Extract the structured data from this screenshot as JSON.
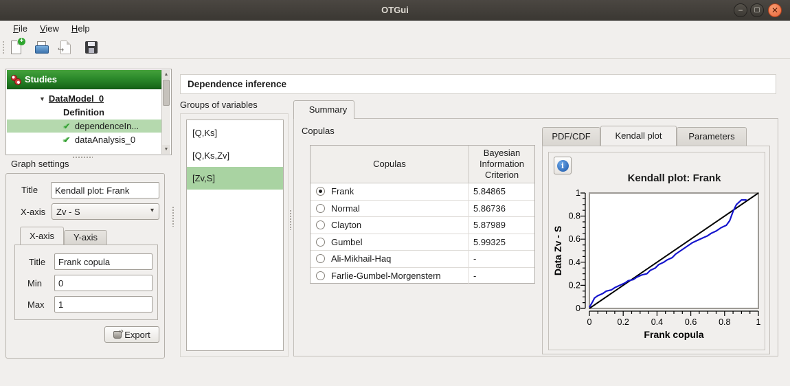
{
  "window": {
    "title": "OTGui"
  },
  "window_controls": {
    "minimize": "−",
    "maximize": "▢",
    "close": "✕"
  },
  "menu": {
    "file": "File",
    "view": "View",
    "help": "Help"
  },
  "toolbar": {
    "buttons": [
      "new-study",
      "open-study",
      "import-python-script",
      "save-study"
    ]
  },
  "studies_tree": {
    "header": "Studies",
    "expander_glyph": "▼",
    "check_glyph": "✔",
    "scroll_up_glyph": "▲",
    "scroll_down_glyph": "▼",
    "items": [
      {
        "label": "DataModel_0",
        "expanded": true,
        "selected": false
      },
      {
        "label": "Definition",
        "expanded": false,
        "selected": false
      },
      {
        "label": "dependenceIn...",
        "expanded": false,
        "selected": true,
        "checked": true
      },
      {
        "label": "dataAnalysis_0",
        "expanded": false,
        "selected": false,
        "checked": true
      }
    ]
  },
  "graph_settings": {
    "section_label": "Graph settings",
    "title_label": "Title",
    "title_value": "Kendall plot: Frank",
    "xaxis_label": "X-axis",
    "xaxis_value": "Zv - S",
    "combo_arrow_glyph": "▾",
    "tabs": [
      {
        "label": "X-axis",
        "active": true
      },
      {
        "label": "Y-axis",
        "active": false
      }
    ],
    "axis_title_label": "Title",
    "axis_title_value": "Frank copula",
    "min_label": "Min",
    "min_value": "0",
    "max_label": "Max",
    "max_value": "1",
    "export_label": "Export"
  },
  "main": {
    "page_title": "Dependence inference",
    "groups_label": "Groups of variables",
    "groups": [
      {
        "label": "[Q,Ks]",
        "selected": false
      },
      {
        "label": "[Q,Ks,Zv]",
        "selected": false
      },
      {
        "label": "[Zv,S]",
        "selected": true
      }
    ],
    "summary_tab": "Summary",
    "copulas_label": "Copulas",
    "table": {
      "col_copulas": "Copulas",
      "col_bic": "Bayesian Information Criterion",
      "rows": [
        {
          "name": "Frank",
          "bic": "5.84865",
          "selected": true
        },
        {
          "name": "Normal",
          "bic": "5.86736",
          "selected": false
        },
        {
          "name": "Clayton",
          "bic": "5.87989",
          "selected": false
        },
        {
          "name": "Gumbel",
          "bic": "5.99325",
          "selected": false
        },
        {
          "name": "Ali-Mikhail-Haq",
          "bic": "-",
          "selected": false
        },
        {
          "name": "Farlie-Gumbel-Morgenstern",
          "bic": "-",
          "selected": false
        }
      ]
    },
    "plot_tabs": [
      {
        "label": "PDF/CDF",
        "active": false
      },
      {
        "label": "Kendall plot",
        "active": true
      },
      {
        "label": "Parameters",
        "active": false
      }
    ],
    "info_glyph": "i"
  },
  "chart_data": {
    "type": "line",
    "title": "Kendall plot: Frank",
    "xlabel": "Frank copula",
    "ylabel": "Data Zv - S",
    "xlim": [
      0,
      1
    ],
    "ylim": [
      0,
      1
    ],
    "xticks": [
      0,
      0.2,
      0.4,
      0.6,
      0.8,
      1
    ],
    "yticks": [
      0,
      0.2,
      0.4,
      0.6,
      0.8,
      1
    ],
    "minor_tick_step": 0.05,
    "grid": false,
    "legend_position": "none",
    "series": [
      {
        "name": "reference y = x",
        "color": "#000000",
        "x": [
          0,
          1
        ],
        "y": [
          0,
          1
        ]
      },
      {
        "name": "empirical Kendall plot (Frank copula)",
        "color": "#1515cd",
        "x": [
          0.0,
          0.02,
          0.03,
          0.05,
          0.08,
          0.1,
          0.13,
          0.15,
          0.18,
          0.21,
          0.23,
          0.26,
          0.28,
          0.31,
          0.34,
          0.36,
          0.39,
          0.41,
          0.44,
          0.46,
          0.49,
          0.51,
          0.54,
          0.56,
          0.59,
          0.61,
          0.64,
          0.67,
          0.7,
          0.72,
          0.75,
          0.78,
          0.81,
          0.83,
          0.85,
          0.87,
          0.9,
          0.93
        ],
        "y": [
          0.01,
          0.06,
          0.09,
          0.11,
          0.13,
          0.15,
          0.16,
          0.18,
          0.2,
          0.22,
          0.24,
          0.25,
          0.27,
          0.29,
          0.3,
          0.33,
          0.35,
          0.38,
          0.4,
          0.42,
          0.44,
          0.47,
          0.5,
          0.52,
          0.55,
          0.57,
          0.59,
          0.61,
          0.63,
          0.65,
          0.67,
          0.7,
          0.72,
          0.76,
          0.84,
          0.9,
          0.94,
          0.94
        ]
      }
    ]
  },
  "colors": {
    "selection_green": "#a9d3a2",
    "tree_selection_green": "#b5d9ae",
    "tree_header_green": "#2c8a2b",
    "titlebar_bg": "#3f3c36",
    "close_button_orange": "#e9663a",
    "info_blue": "#2a66b5",
    "curve_blue": "#1515cd",
    "reference_black": "#000000"
  }
}
